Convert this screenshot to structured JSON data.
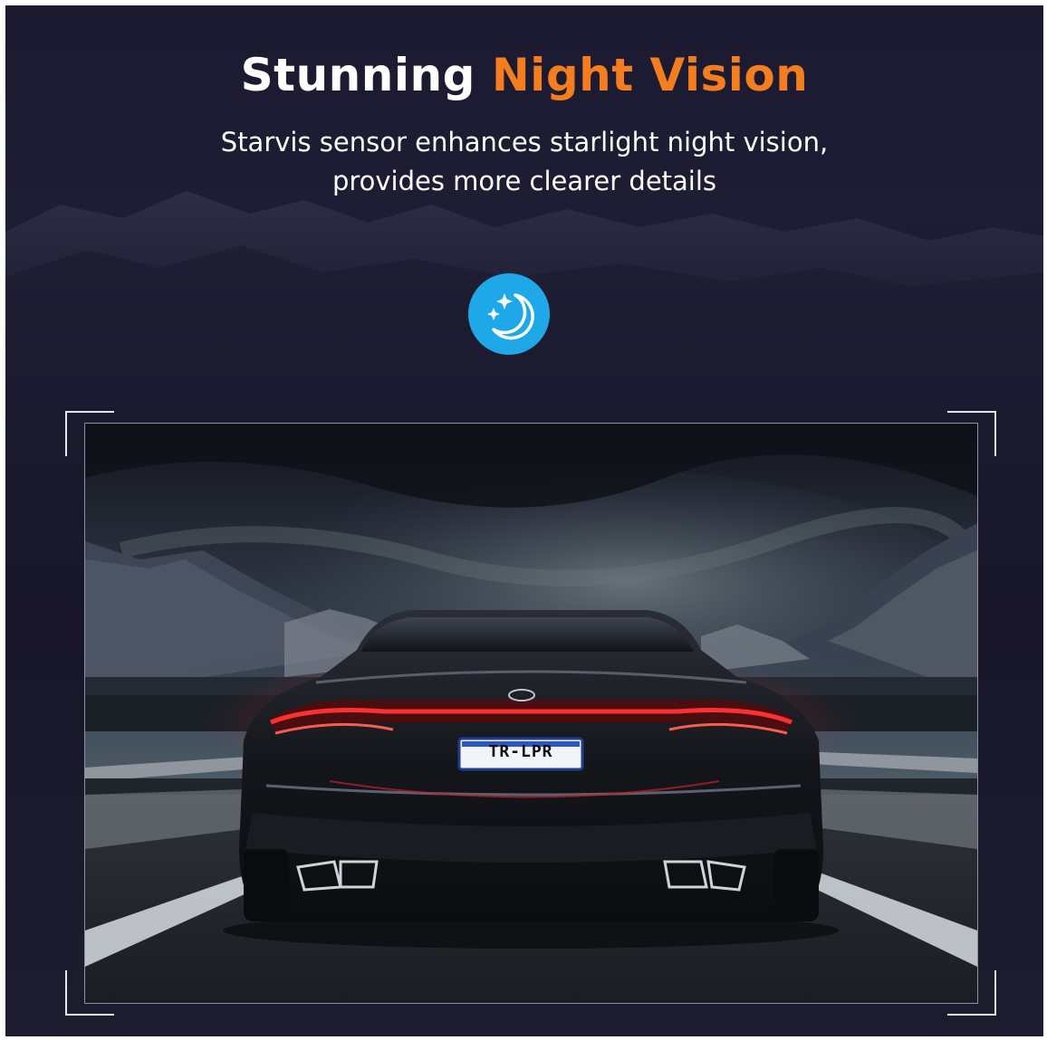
{
  "header": {
    "title_prefix": "Stunning",
    "title_accent": "Night Vision",
    "subtitle_line1": "Starvis sensor enhances starlight night vision,",
    "subtitle_line2": "provides more clearer details"
  },
  "icon": {
    "name": "moon-stars-icon",
    "color": "#1ea8e8"
  },
  "photo": {
    "plate_text": "TR-LPR"
  },
  "colors": {
    "accent": "#f47d1f",
    "background": "#1b1a30",
    "text": "#ffffff"
  }
}
